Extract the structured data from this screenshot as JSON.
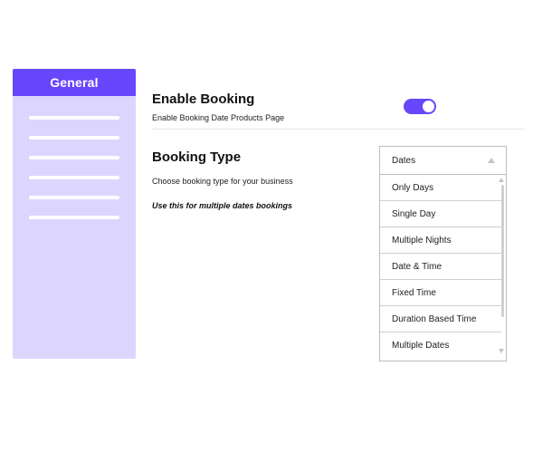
{
  "sidebar": {
    "header_label": "General",
    "placeholder_line_count": 6
  },
  "enable_booking": {
    "title": "Enable Booking",
    "description": "Enable Booking Date Products Page",
    "toggle_on": true
  },
  "booking_type": {
    "title": "Booking Type",
    "description": "Choose booking type for your business",
    "note": "Use this for multiple dates bookings",
    "select": {
      "selected": "Dates",
      "options": [
        "Only Days",
        "Single Day",
        "Multiple Nights",
        "Date & Time",
        "Fixed Time",
        "Duration Based Time",
        "Multiple Dates"
      ]
    }
  },
  "colors": {
    "accent": "#6746fb",
    "sidebar_bg": "#dcd6ff"
  }
}
